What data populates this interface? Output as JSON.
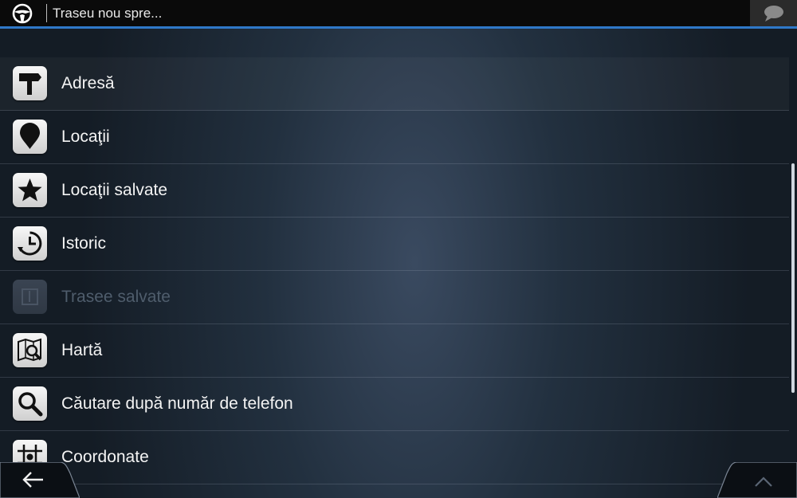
{
  "header": {
    "title": "Traseu nou spre...",
    "icon": "steering-wheel-icon",
    "chat_icon": "speech-bubble-icon"
  },
  "menu": {
    "items": [
      {
        "label": "Adresă",
        "icon": "signpost-icon",
        "enabled": true
      },
      {
        "label": "Locaţii",
        "icon": "location-pin-icon",
        "enabled": true
      },
      {
        "label": "Locaţii salvate",
        "icon": "star-icon",
        "enabled": true
      },
      {
        "label": "Istoric",
        "icon": "history-clock-icon",
        "enabled": true
      },
      {
        "label": "Trasee salvate",
        "icon": "saved-route-icon",
        "enabled": false
      },
      {
        "label": "Hartă",
        "icon": "map-search-icon",
        "enabled": true
      },
      {
        "label": "Căutare după număr de telefon",
        "icon": "magnifier-icon",
        "enabled": true
      },
      {
        "label": "Coordonate",
        "icon": "grid-coordinates-icon",
        "enabled": true
      }
    ]
  },
  "footer": {
    "back_icon": "back-arrow-icon",
    "up_icon": "chevron-up-icon"
  },
  "colors": {
    "accent": "#2f78c8",
    "background": "#1c2632",
    "text": "#f4f4f4",
    "disabled_text": "#4f5d6c"
  }
}
